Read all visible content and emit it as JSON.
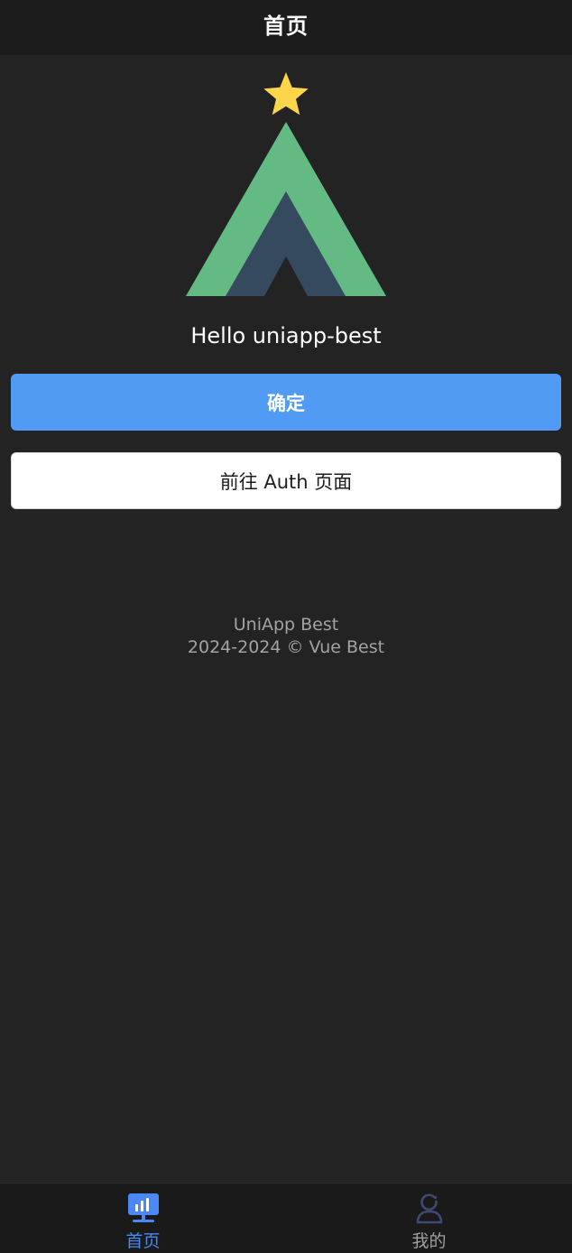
{
  "navbar": {
    "title": "首页"
  },
  "logo": {
    "icon": "vue-star-logo",
    "colors": {
      "star": "#ffd54a",
      "outer": "#63bb83",
      "inner": "#354a5e"
    }
  },
  "main": {
    "greeting": "Hello uniapp-best",
    "confirm_button": "确定",
    "auth_button": "前往 Auth 页面"
  },
  "footer": {
    "line1": "UniApp Best",
    "line2": "2024-2024 © Vue Best"
  },
  "tabbar": {
    "tabs": [
      {
        "label": "首页",
        "icon": "dashboard-icon",
        "active": true
      },
      {
        "label": "我的",
        "icon": "user-icon",
        "active": false
      }
    ]
  },
  "colors": {
    "background": "#232323",
    "navbar": "#1c1c1c",
    "primary": "#519bf5",
    "tab_active": "#4a88f6"
  }
}
